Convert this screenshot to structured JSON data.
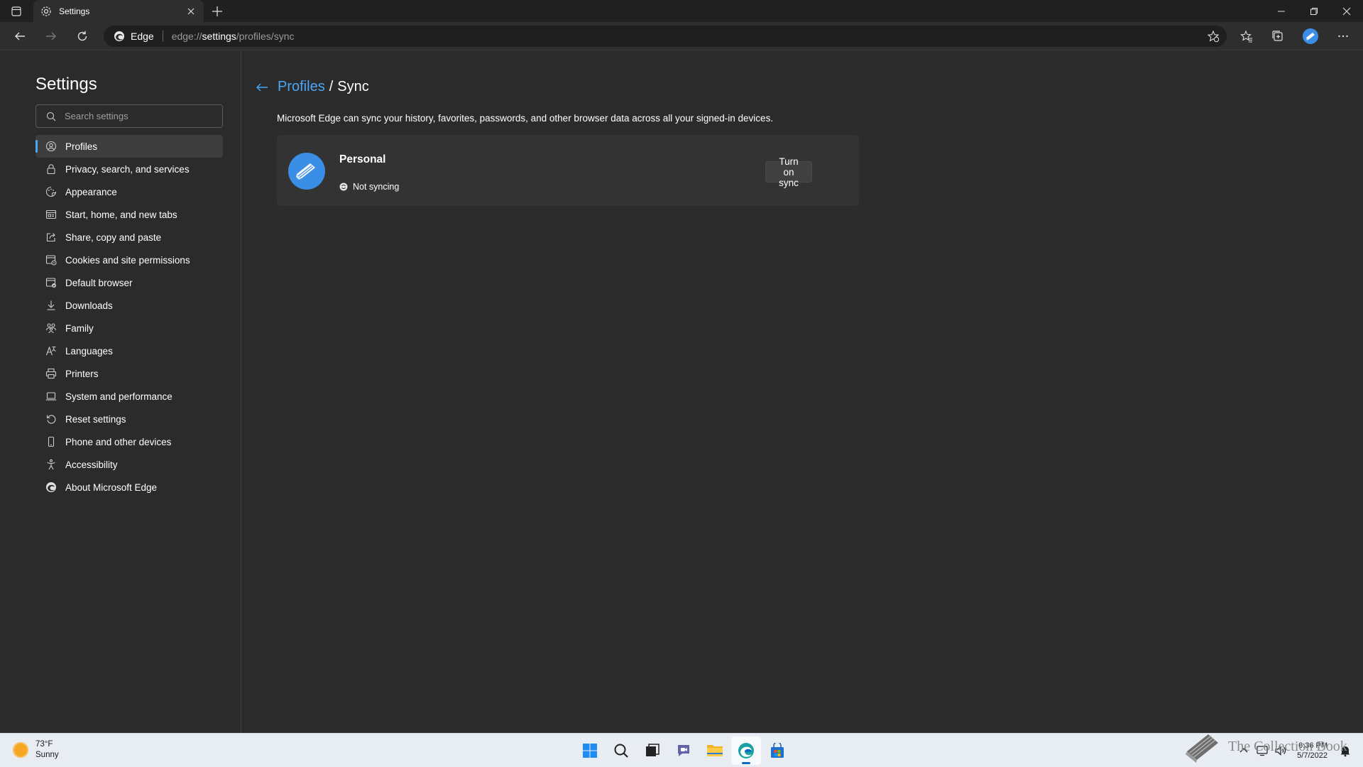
{
  "window": {
    "tab_title": "Settings"
  },
  "address_bar": {
    "site_label": "Edge",
    "url_prefix": "edge://",
    "url_host": "settings",
    "url_path": "/profiles/sync"
  },
  "sidebar": {
    "title": "Settings",
    "search_placeholder": "Search settings",
    "items": [
      {
        "label": "Profiles",
        "icon": "profile-icon",
        "active": true
      },
      {
        "label": "Privacy, search, and services",
        "icon": "lock-icon"
      },
      {
        "label": "Appearance",
        "icon": "appearance-icon"
      },
      {
        "label": "Start, home, and new tabs",
        "icon": "home-tabs-icon"
      },
      {
        "label": "Share, copy and paste",
        "icon": "share-icon"
      },
      {
        "label": "Cookies and site permissions",
        "icon": "cookies-icon"
      },
      {
        "label": "Default browser",
        "icon": "default-browser-icon"
      },
      {
        "label": "Downloads",
        "icon": "download-icon"
      },
      {
        "label": "Family",
        "icon": "family-icon"
      },
      {
        "label": "Languages",
        "icon": "languages-icon"
      },
      {
        "label": "Printers",
        "icon": "printer-icon"
      },
      {
        "label": "System and performance",
        "icon": "laptop-icon"
      },
      {
        "label": "Reset settings",
        "icon": "reset-icon"
      },
      {
        "label": "Phone and other devices",
        "icon": "phone-icon"
      },
      {
        "label": "Accessibility",
        "icon": "accessibility-icon"
      },
      {
        "label": "About Microsoft Edge",
        "icon": "edge-logo-icon"
      }
    ]
  },
  "main": {
    "breadcrumb_parent": "Profiles",
    "breadcrumb_separator": "/",
    "breadcrumb_current": "Sync",
    "description": "Microsoft Edge can sync your history, favorites, passwords, and other browser data across all your signed-in devices.",
    "profile": {
      "name": "Personal",
      "status": "Not syncing",
      "button": "Turn on sync"
    }
  },
  "taskbar": {
    "weather_temp": "73°F",
    "weather_desc": "Sunny",
    "time": "6:36 PM",
    "date": "5/7/2022",
    "watermark": "The Collection Book"
  },
  "colors": {
    "accent": "#4aa7f5",
    "background": "#2b2b2b",
    "card": "#333333"
  }
}
